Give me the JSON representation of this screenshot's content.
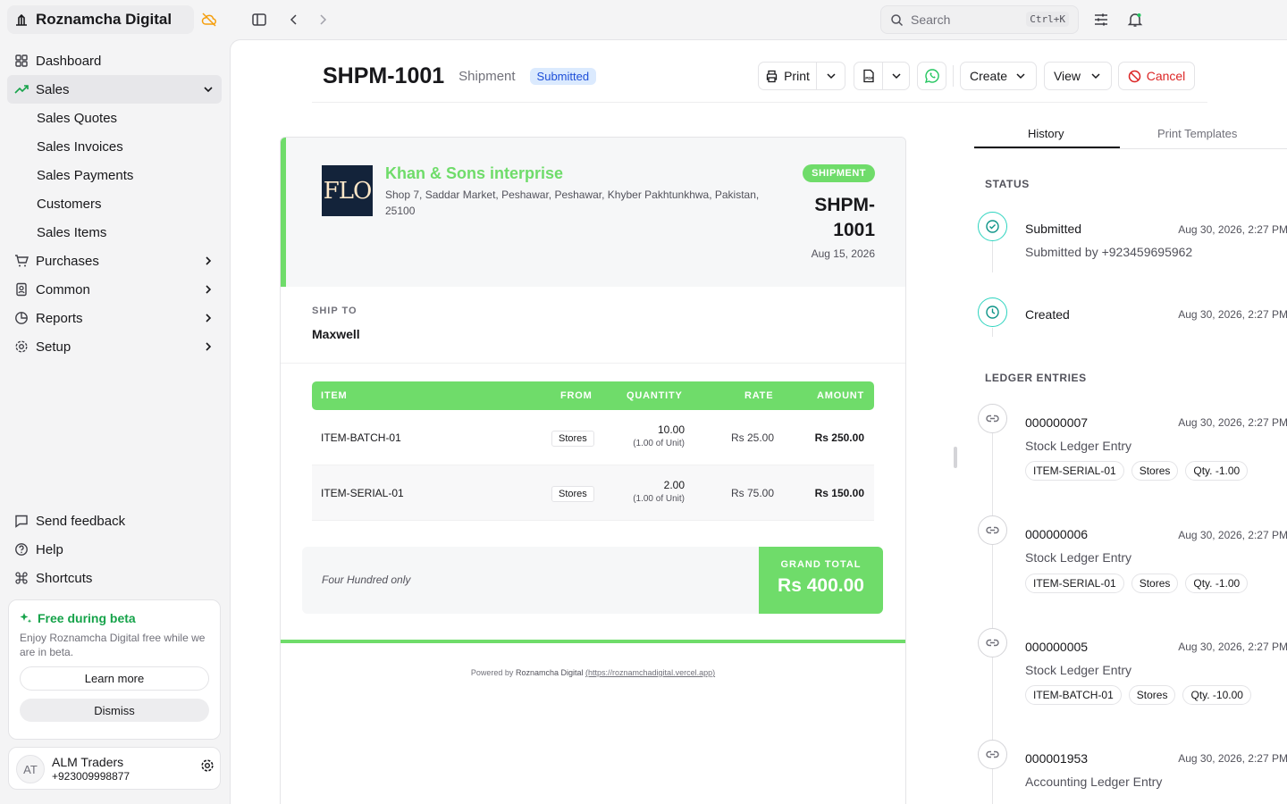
{
  "app": {
    "name": "Roznamcha Digital"
  },
  "sidebar": {
    "items": [
      {
        "label": "Dashboard"
      },
      {
        "label": "Sales"
      },
      {
        "label": "Purchases"
      },
      {
        "label": "Common"
      },
      {
        "label": "Reports"
      },
      {
        "label": "Setup"
      }
    ],
    "sales_sub": [
      "Sales Quotes",
      "Sales Invoices",
      "Sales Payments",
      "Customers",
      "Sales Items"
    ],
    "bottom": [
      {
        "label": "Send feedback"
      },
      {
        "label": "Help"
      },
      {
        "label": "Shortcuts"
      }
    ],
    "beta": {
      "title": "Free during beta",
      "desc": "Enjoy Roznamcha Digital free while we are in beta.",
      "learn": "Learn more",
      "dismiss": "Dismiss"
    },
    "user": {
      "initials": "AT",
      "name": "ALM Traders",
      "phone": "+923009998877"
    }
  },
  "topbar": {
    "search_placeholder": "Search",
    "shortcut": "Ctrl+K"
  },
  "header": {
    "doc_no": "SHPM-1001",
    "doc_type": "Shipment",
    "status": "Submitted",
    "actions": {
      "print": "Print",
      "create": "Create",
      "view": "View",
      "cancel": "Cancel"
    }
  },
  "document": {
    "logo_text": "FLO",
    "company": "Khan & Sons interprise",
    "address": "Shop 7, Saddar Market, Peshawar, Peshawar, Khyber Pakhtunkhwa, Pakistan, 25100",
    "tag": "SHIPMENT",
    "number": "SHPM-1001",
    "date": "Aug 15, 2026",
    "ship_to_label": "SHIP TO",
    "ship_to": "Maxwell",
    "columns": [
      "ITEM",
      "FROM",
      "QUANTITY",
      "RATE",
      "AMOUNT"
    ],
    "rows": [
      {
        "item": "ITEM-BATCH-01",
        "from": "Stores",
        "qty": "10.00",
        "unit": "(1.00 of Unit)",
        "rate": "Rs 25.00",
        "amount": "Rs 250.00"
      },
      {
        "item": "ITEM-SERIAL-01",
        "from": "Stores",
        "qty": "2.00",
        "unit": "(1.00 of Unit)",
        "rate": "Rs 75.00",
        "amount": "Rs 150.00"
      }
    ],
    "amount_words": "Four Hundred only",
    "grand_total_label": "GRAND TOTAL",
    "grand_total": "Rs 400.00",
    "powered_prefix": "Powered by",
    "powered_name": "Roznamcha Digital",
    "powered_link": "(https://roznamchadigital.vercel.app)"
  },
  "panel": {
    "tabs": [
      "History",
      "Print Templates"
    ],
    "status_title": "STATUS",
    "status": [
      {
        "title": "Submitted",
        "time": "Aug 30, 2026, 2:27 PM",
        "sub": "Submitted by +923459695962"
      },
      {
        "title": "Created",
        "time": "Aug 30, 2026, 2:27 PM"
      }
    ],
    "ledger_title": "LEDGER ENTRIES",
    "ledger": [
      {
        "id": "000000007",
        "time": "Aug 30, 2026, 2:27 PM",
        "type": "Stock Ledger Entry",
        "chips": [
          "ITEM-SERIAL-01",
          "Stores",
          "Qty. -1.00"
        ]
      },
      {
        "id": "000000006",
        "time": "Aug 30, 2026, 2:27 PM",
        "type": "Stock Ledger Entry",
        "chips": [
          "ITEM-SERIAL-01",
          "Stores",
          "Qty. -1.00"
        ]
      },
      {
        "id": "000000005",
        "time": "Aug 30, 2026, 2:27 PM",
        "type": "Stock Ledger Entry",
        "chips": [
          "ITEM-BATCH-01",
          "Stores",
          "Qty. -10.00"
        ]
      },
      {
        "id": "000001953",
        "time": "Aug 30, 2026, 2:27 PM",
        "type": "Accounting Ledger Entry"
      }
    ]
  },
  "colors": {
    "accent": "#6fdc6a",
    "badge_bg": "#dbeafe",
    "badge_text": "#1d4ed8",
    "cancel": "#dc2626",
    "beta": "#16a34a"
  }
}
